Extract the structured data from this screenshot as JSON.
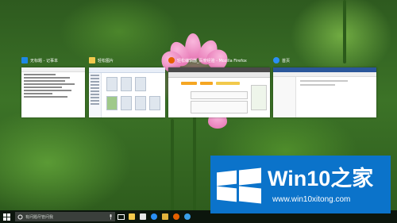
{
  "task_view": {
    "windows": [
      {
        "title": "无标题 - 记事本",
        "icon": "notepad-icon",
        "icon_color": "#1e88e5"
      },
      {
        "title": "轻松图片",
        "icon": "folder-icon",
        "icon_color": "#f2c94c"
      },
      {
        "title": "轻松编辑器_百度经验 - Mozilla Firefox",
        "icon": "firefox-icon",
        "icon_color": "#e66000"
      },
      {
        "title": "首页",
        "icon": "explorer-icon",
        "icon_color": "#2b8ff5"
      }
    ]
  },
  "taskbar": {
    "search_placeholder": "有问题尽管问我",
    "apps": [
      "task-view-icon",
      "file-explorer-icon",
      "notepad-icon",
      "edge-icon",
      "folder-icon",
      "firefox-icon",
      "app-icon"
    ]
  },
  "watermark": {
    "title": "Win10之家",
    "url": "www.win10xitong.com",
    "brand_color": "#0b73ca"
  }
}
